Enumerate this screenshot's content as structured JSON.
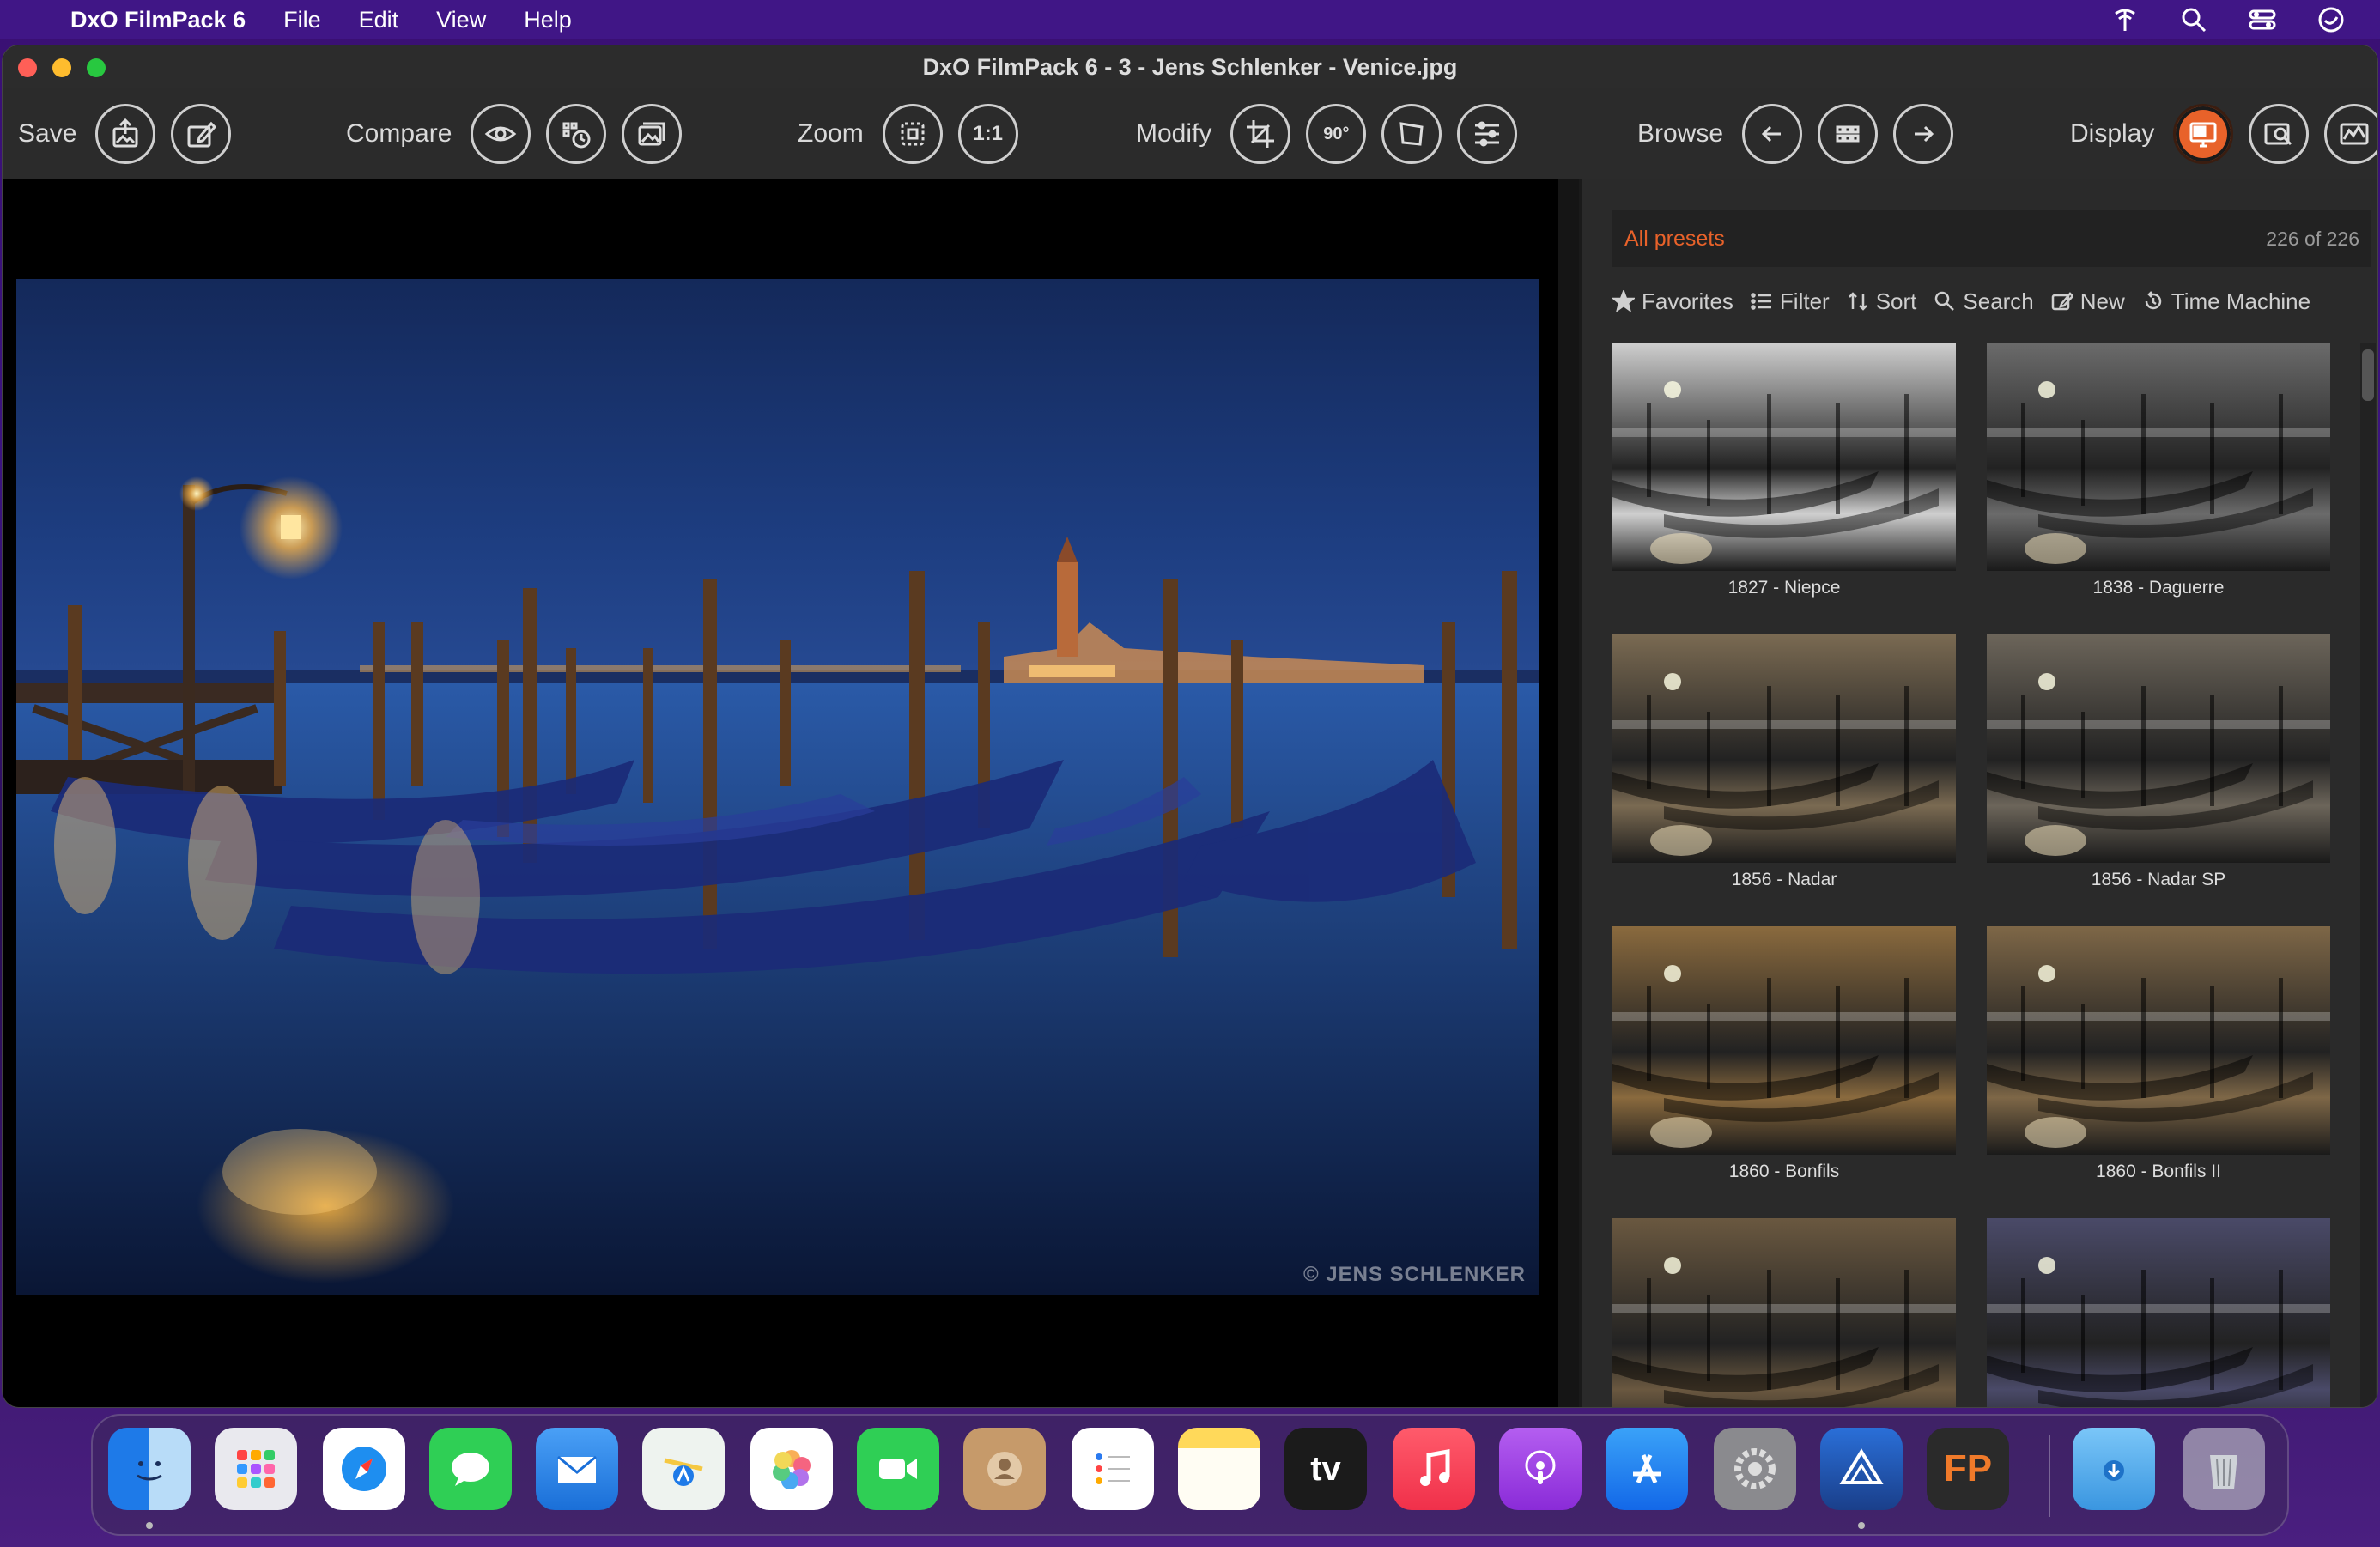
{
  "menubar": {
    "app_name": "DxO FilmPack 6",
    "items": [
      "File",
      "Edit",
      "View",
      "Help"
    ]
  },
  "window": {
    "title": "DxO FilmPack 6 - 3 - Jens Schlenker - Venice.jpg"
  },
  "toolbar": {
    "save_label": "Save",
    "compare_label": "Compare",
    "zoom_label": "Zoom",
    "zoom_1to1": "1:1",
    "modify_label": "Modify",
    "rotate_label": "90°",
    "browse_label": "Browse",
    "display_label": "Display"
  },
  "viewer": {
    "copyright": "© JENS SCHLENKER"
  },
  "presets": {
    "title": "All presets",
    "count": "226 of 226",
    "actions": {
      "favorites": "Favorites",
      "filter": "Filter",
      "sort": "Sort",
      "search": "Search",
      "new": "New",
      "time_machine": "Time Machine"
    },
    "items": [
      {
        "label": "1827 - Niepce",
        "tone": "#cfcfcf"
      },
      {
        "label": "1838 - Daguerre",
        "tone": "#6b6b6b"
      },
      {
        "label": "1856 - Nadar",
        "tone": "#7a6a52"
      },
      {
        "label": "1856 - Nadar SP",
        "tone": "#6c655a"
      },
      {
        "label": "1860 - Bonfils",
        "tone": "#8a6a3e"
      },
      {
        "label": "1860 - Bonfils II",
        "tone": "#7e6747"
      },
      {
        "label": "",
        "tone": "#6a5840"
      },
      {
        "label": "",
        "tone": "#4a4a68"
      }
    ]
  },
  "dock": {
    "apps": [
      "Finder",
      "Launchpad",
      "Safari",
      "Messages",
      "Mail",
      "Maps",
      "Photos",
      "FaceTime",
      "Contacts",
      "Reminders",
      "Notes",
      "TV",
      "Music",
      "Podcasts",
      "App Store",
      "System Preferences",
      "Affinity",
      "DxO FilmPack",
      "Downloads",
      "Trash"
    ],
    "tv_label": "tv",
    "dxo_label": "FP"
  },
  "colors": {
    "accent": "#e8622a"
  }
}
